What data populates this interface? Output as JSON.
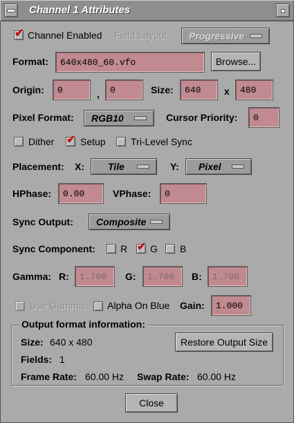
{
  "window": {
    "title": "Channel 1 Attributes"
  },
  "channel_enabled": {
    "label": "Channel Enabled",
    "checked": true
  },
  "field_layout": {
    "label": "Field Layout:",
    "value": "Progressive"
  },
  "format": {
    "label": "Format:",
    "value": "640x480_60.vfo",
    "browse_label": "Browse..."
  },
  "origin": {
    "label": "Origin:",
    "x": "0",
    "sep": ",",
    "y": "0"
  },
  "size": {
    "label": "Size:",
    "w": "640",
    "sep": "x",
    "h": "480"
  },
  "pixel_format": {
    "label": "Pixel Format:",
    "value": "RGB10"
  },
  "cursor_priority": {
    "label": "Cursor Priority:",
    "value": "0"
  },
  "options": {
    "dither": {
      "label": "Dither",
      "checked": false
    },
    "setup": {
      "label": "Setup",
      "checked": true
    },
    "tri_level_sync": {
      "label": "Tri-Level Sync",
      "checked": false
    }
  },
  "placement": {
    "label": "Placement:",
    "x_label": "X:",
    "x_value": "Tile",
    "y_label": "Y:",
    "y_value": "Pixel"
  },
  "hphase": {
    "label": "HPhase:",
    "value": "0.00"
  },
  "vphase": {
    "label": "VPhase:",
    "value": "0"
  },
  "sync_output": {
    "label": "Sync Output:",
    "value": "Composite"
  },
  "sync_component": {
    "label": "Sync Component:",
    "r": {
      "label": "R",
      "checked": false
    },
    "g": {
      "label": "G",
      "checked": true
    },
    "b": {
      "label": "B",
      "checked": false
    }
  },
  "gamma": {
    "label": "Gamma:",
    "r_label": "R:",
    "r": "1.700",
    "g_label": "G:",
    "g": "1.700",
    "b_label": "B:",
    "b": "1.700"
  },
  "use_gamma": {
    "label": "Use Gamma",
    "checked": false
  },
  "alpha_on_blue": {
    "label": "Alpha On Blue",
    "checked": false
  },
  "gain": {
    "label": "Gain:",
    "value": "1.000"
  },
  "output_info": {
    "title": "Output format information:",
    "size_label": "Size:",
    "size_value": "640 x 480",
    "fields_label": "Fields:",
    "fields_value": "1",
    "frame_rate_label": "Frame Rate:",
    "frame_rate_value": "60.00 Hz",
    "swap_rate_label": "Swap Rate:",
    "swap_rate_value": "60.00 Hz",
    "restore_label": "Restore Output Size"
  },
  "close_label": "Close",
  "colors": {
    "field_bg": "#c08a90",
    "window_bg": "#aaaaaa",
    "check": "#c01010"
  }
}
